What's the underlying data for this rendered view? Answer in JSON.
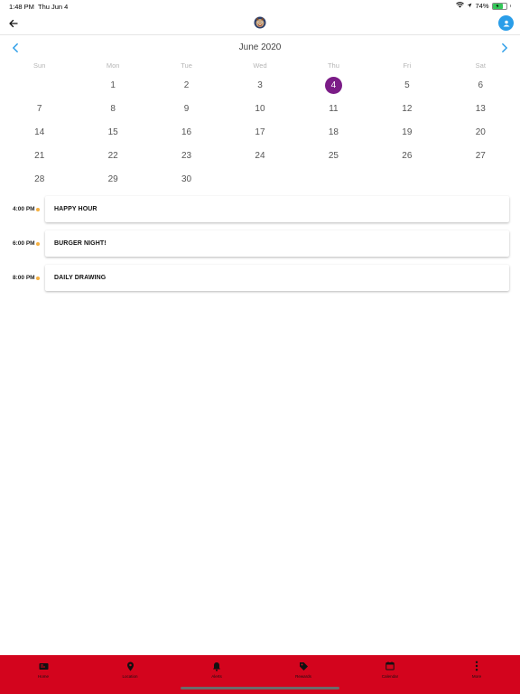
{
  "status_bar": {
    "time": "1:48 PM",
    "date": "Thu Jun 4",
    "battery": "74%",
    "battery_level": 0.74
  },
  "header": {
    "back_icon": "arrow-left-icon",
    "logo_icon": "mascot-logo-icon",
    "profile_icon": "user-icon"
  },
  "calendar": {
    "month_title": "June 2020",
    "weekdays": [
      "Sun",
      "Mon",
      "Tue",
      "Wed",
      "Thu",
      "Fri",
      "Sat"
    ],
    "first_day_offset": 1,
    "days_in_month": 30,
    "selected_day": 4,
    "accent_color": "#7b1c87",
    "nav_color": "#2a9de8"
  },
  "events": [
    {
      "time": "4:00 PM",
      "title": "HAPPY HOUR"
    },
    {
      "time": "6:00 PM",
      "title": "BURGER NIGHT!"
    },
    {
      "time": "8:00 PM",
      "title": "DAILY DRAWING"
    }
  ],
  "event_dot_color": "#f5b041",
  "bottom_nav": {
    "bg_color": "#d3041d",
    "items": [
      {
        "label": "Home",
        "icon": "home-icon"
      },
      {
        "label": "Location",
        "icon": "location-pin-icon"
      },
      {
        "label": "Alerts",
        "icon": "bell-icon"
      },
      {
        "label": "Rewards",
        "icon": "tag-icon"
      },
      {
        "label": "Calendar",
        "icon": "calendar-icon"
      },
      {
        "label": "More",
        "icon": "more-vertical-icon"
      }
    ]
  }
}
